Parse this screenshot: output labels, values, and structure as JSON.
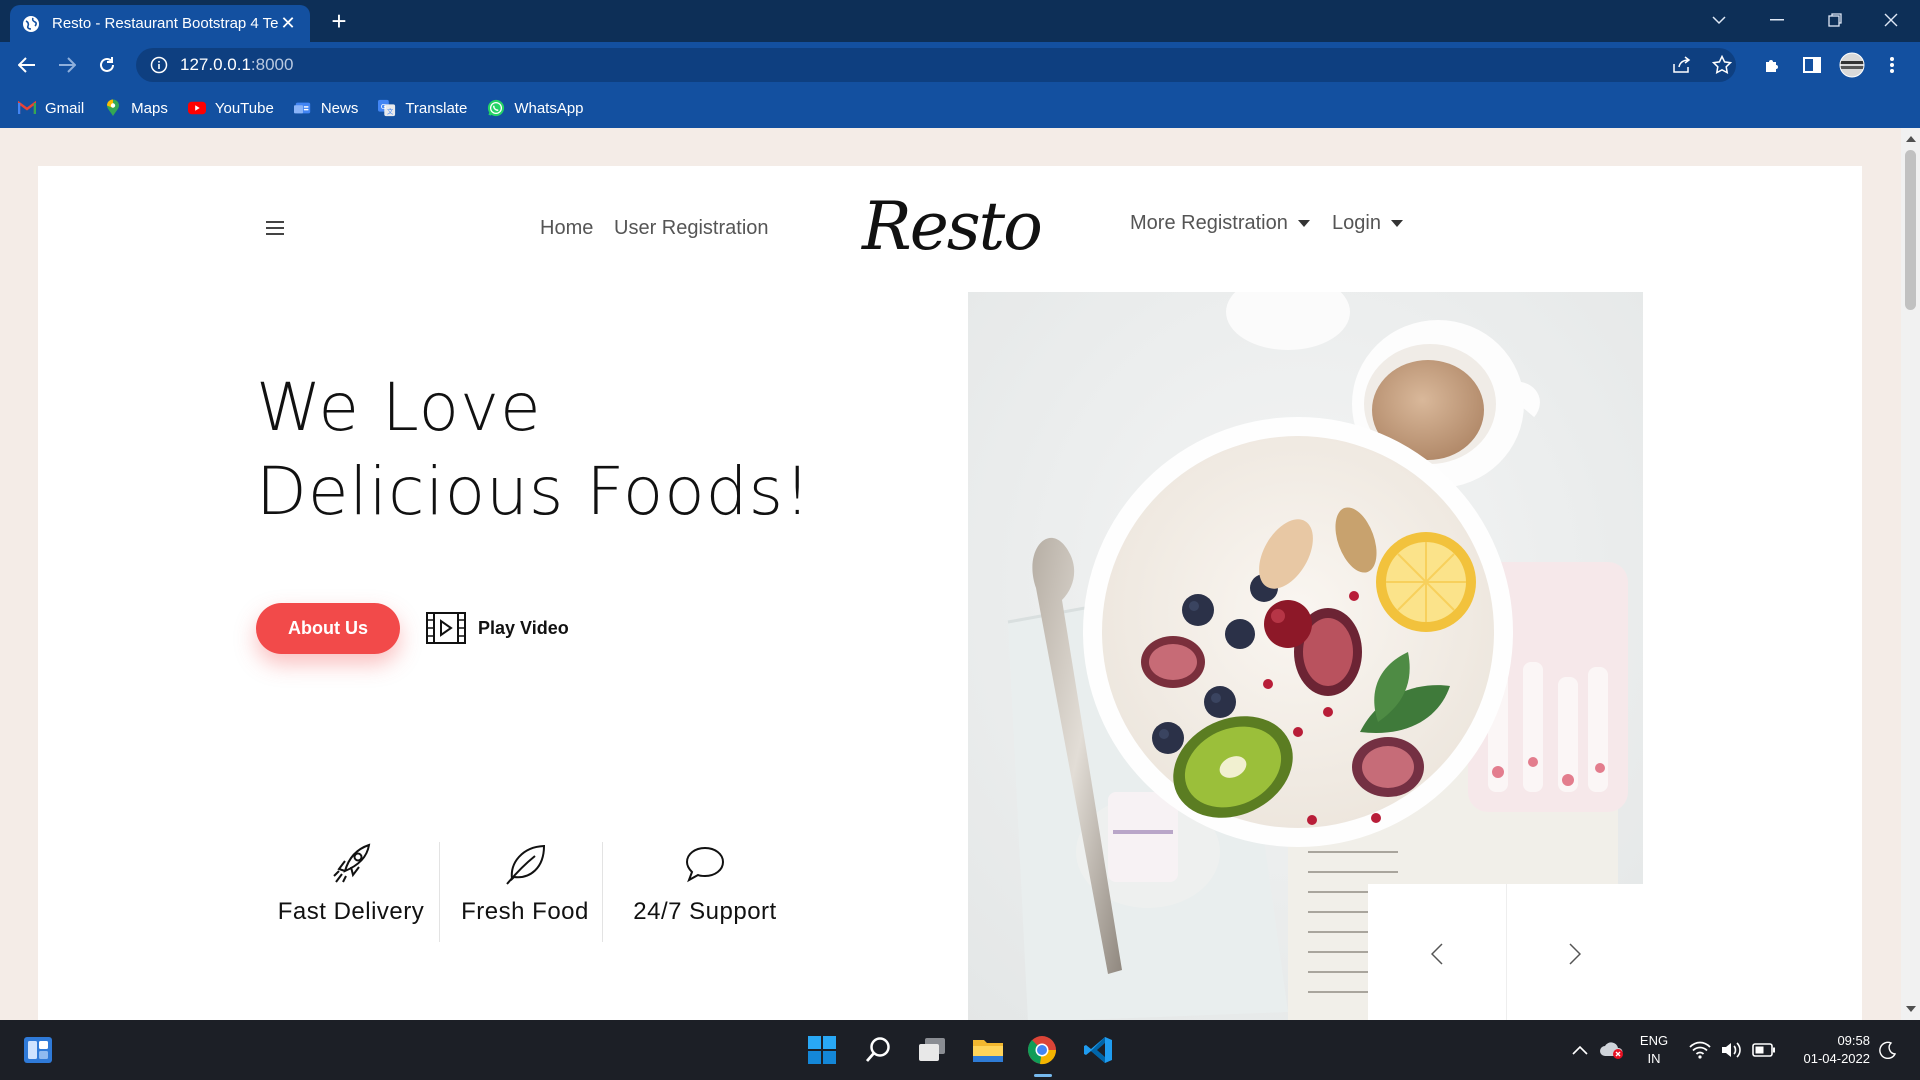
{
  "browser": {
    "tab_title": "Resto - Restaurant Bootstrap 4 Te",
    "url_host": "127.0.0.1",
    "url_port": ":8000",
    "bookmarks": [
      {
        "label": "Gmail",
        "icon": "gmail-icon"
      },
      {
        "label": "Maps",
        "icon": "maps-icon"
      },
      {
        "label": "YouTube",
        "icon": "youtube-icon"
      },
      {
        "label": "News",
        "icon": "news-icon"
      },
      {
        "label": "Translate",
        "icon": "translate-icon"
      },
      {
        "label": "WhatsApp",
        "icon": "whatsapp-icon"
      }
    ]
  },
  "site": {
    "nav": {
      "home": "Home",
      "user_registration": "User Registration",
      "more_registration": "More Registration",
      "login": "Login"
    },
    "logo": "Resto",
    "hero": {
      "line1": "We Love",
      "line2": "Delicious Foods!",
      "about_button": "About Us",
      "play_video": "Play Video"
    },
    "features": [
      {
        "label": "Fast Delivery",
        "icon": "rocket-icon"
      },
      {
        "label": "Fresh Food",
        "icon": "leaf-icon"
      },
      {
        "label": "24/7 Support",
        "icon": "chat-bubble-icon"
      }
    ]
  },
  "taskbar": {
    "lang_line1": "ENG",
    "lang_line2": "IN",
    "time": "09:58",
    "date": "01-04-2022"
  },
  "colors": {
    "browser_dark": "#0d2f57",
    "browser_blue": "#1350a0",
    "accent_red": "#f24a4a",
    "page_bg": "#f4ece7",
    "taskbar": "#1c1f26"
  }
}
